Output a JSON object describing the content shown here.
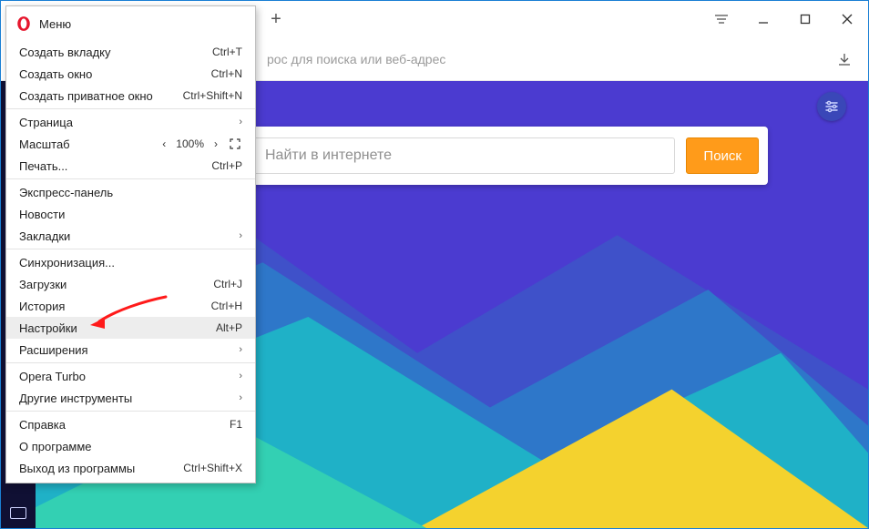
{
  "window": {
    "menu_label": "Меню"
  },
  "addressbar": {
    "placeholder": "рос для поиска или веб-адрес"
  },
  "search": {
    "placeholder": "Найти в интернете",
    "button": "Поиск"
  },
  "menu": {
    "items": [
      {
        "label": "Создать вкладку",
        "shortcut": "Ctrl+T",
        "type": "item"
      },
      {
        "label": "Создать окно",
        "shortcut": "Ctrl+N",
        "type": "item"
      },
      {
        "label": "Создать приватное окно",
        "shortcut": "Ctrl+Shift+N",
        "type": "item"
      },
      {
        "type": "sep"
      },
      {
        "label": "Страница",
        "type": "submenu"
      },
      {
        "label": "Масштаб",
        "type": "zoom",
        "zoom": "100%"
      },
      {
        "label": "Печать...",
        "shortcut": "Ctrl+P",
        "type": "item"
      },
      {
        "type": "sep"
      },
      {
        "label": "Экспресс-панель",
        "type": "item"
      },
      {
        "label": "Новости",
        "type": "item"
      },
      {
        "label": "Закладки",
        "type": "submenu"
      },
      {
        "type": "sep"
      },
      {
        "label": "Синхронизация...",
        "type": "item"
      },
      {
        "label": "Загрузки",
        "shortcut": "Ctrl+J",
        "type": "item"
      },
      {
        "label": "История",
        "shortcut": "Ctrl+H",
        "type": "item"
      },
      {
        "label": "Настройки",
        "shortcut": "Alt+P",
        "type": "item",
        "hover": true
      },
      {
        "label": "Расширения",
        "type": "submenu"
      },
      {
        "type": "sep"
      },
      {
        "label": "Opera Turbo",
        "type": "submenu"
      },
      {
        "label": "Другие инструменты",
        "type": "submenu"
      },
      {
        "type": "sep"
      },
      {
        "label": "Справка",
        "shortcut": "F1",
        "type": "item"
      },
      {
        "label": "О программе",
        "type": "item"
      },
      {
        "label": "Выход из программы",
        "shortcut": "Ctrl+Shift+X",
        "type": "item"
      }
    ]
  }
}
